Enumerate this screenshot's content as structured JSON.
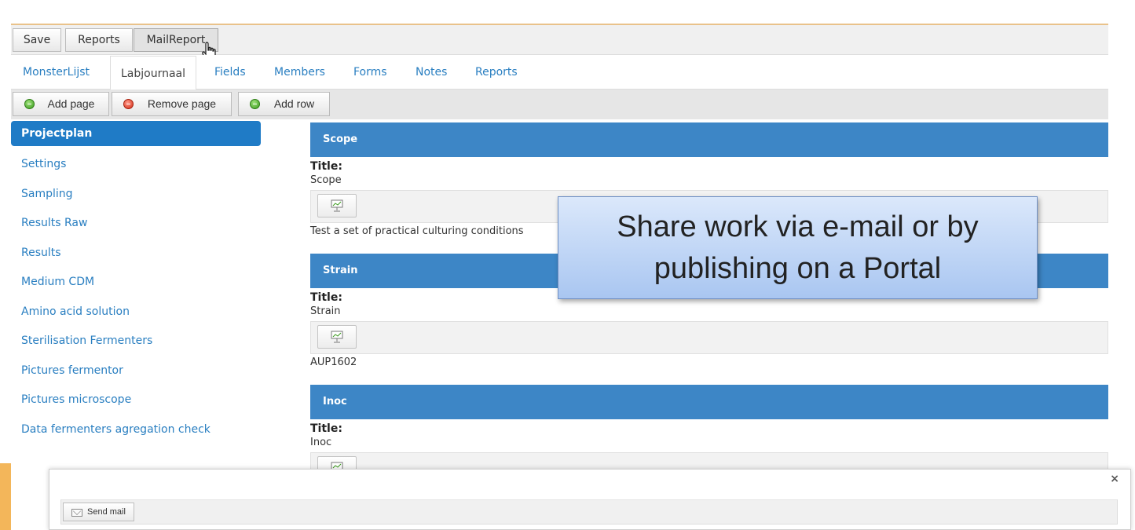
{
  "toolbar": {
    "save_label": "Save",
    "reports_label": "Reports",
    "mailreport_label": "MailReport"
  },
  "tabs": [
    {
      "label": "MonsterLijst"
    },
    {
      "label": "Labjournaal"
    },
    {
      "label": "Fields"
    },
    {
      "label": "Members"
    },
    {
      "label": "Forms"
    },
    {
      "label": "Notes"
    },
    {
      "label": "Reports"
    }
  ],
  "active_tab": "Labjournaal",
  "pagebar": {
    "add_page_label": "Add page",
    "remove_page_label": "Remove page",
    "add_row_label": "Add row"
  },
  "sidebar": {
    "items": [
      {
        "label": "Projectplan"
      },
      {
        "label": "Settings"
      },
      {
        "label": "Sampling"
      },
      {
        "label": "Results Raw"
      },
      {
        "label": "Results"
      },
      {
        "label": "Medium CDM"
      },
      {
        "label": "Amino acid solution"
      },
      {
        "label": "Sterilisation Fermenters"
      },
      {
        "label": "Pictures fermentor"
      },
      {
        "label": "Pictures microscope"
      },
      {
        "label": "Data fermenters agregation check"
      }
    ],
    "active_item": "Projectplan"
  },
  "sections": [
    {
      "header": "Scope",
      "title_label": "Title:",
      "title_value": "Scope",
      "text": "Test a set of practical culturing conditions"
    },
    {
      "header": "Strain",
      "title_label": "Title:",
      "title_value": "Strain",
      "text": "AUP1602"
    },
    {
      "header": "Inoc",
      "title_label": "Title:",
      "title_value": "Inoc",
      "text": ""
    }
  ],
  "callout": {
    "line1": "Share work via e-mail or by",
    "line2": "publishing on a Portal"
  },
  "modal": {
    "close_symbol": "×",
    "send_mail_label": "Send mail"
  },
  "colors": {
    "accent_blue": "#3d86c6",
    "link_blue": "#2a7fc1",
    "active_sidebar": "#1f7bc6",
    "callout_top": "#dbe8fb",
    "callout_bottom": "#a9c6f1"
  }
}
